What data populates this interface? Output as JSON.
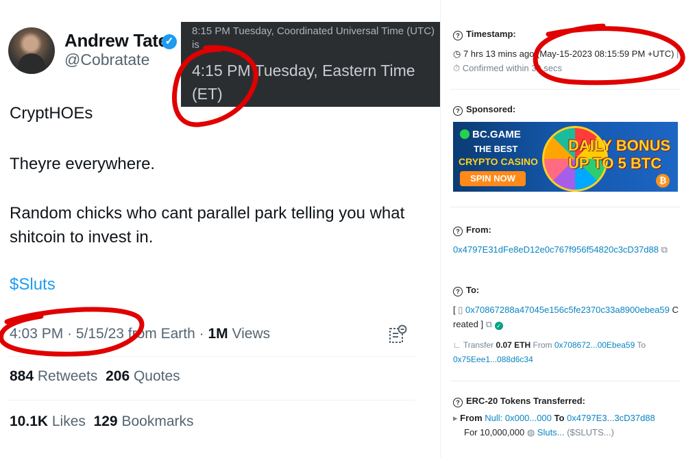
{
  "tweet": {
    "author_name": "Andrew Tate",
    "author_handle": "@Cobratate",
    "verified_icon": "verified-badge-icon",
    "lines": [
      "CryptHOEs",
      "Theyre everywhere.",
      "Random chicks who cant parallel park telling you what shitcoin to invest in."
    ],
    "cashtag": "$Sluts",
    "meta_time": "4:03 PM · 5/15/23 from Earth · ",
    "meta_views_count": "1M",
    "meta_views_label": " Views",
    "retweets_count": "884",
    "retweets_label": " Retweets",
    "quotes_count": "206",
    "quotes_label": " Quotes",
    "likes_count": "10.1K",
    "likes_label": " Likes",
    "bookmarks_count": "129",
    "bookmarks_label": " Bookmarks"
  },
  "tooltip": {
    "utc_line": "8:15 PM Tuesday, Coordinated Universal Time (UTC) is",
    "et_line": "4:15 PM Tuesday, Eastern Time (ET)"
  },
  "etherscan": {
    "timestamp_label": "Timestamp:",
    "timestamp_value": "7 hrs 13 mins ago (May-15-2023 08:15:59 PM +UTC)",
    "confirmed": "Confirmed within 30 secs",
    "sponsored_label": "Sponsored:",
    "banner": {
      "brand": "BC.GAME",
      "best": "THE BEST",
      "casino": "CRYPTO CASINO",
      "spin": "SPIN NOW",
      "daily": "DAILY BONUS",
      "upto": "UP TO 5 BTC"
    },
    "from_label": "From:",
    "from_address": "0x4797E31dFe8eD12e0c767f956f54820c3cD37d88",
    "to_label": "To:",
    "to_address": "0x70867288a47045e156c5fe2370c33a8900ebea59",
    "to_created": "Created ]",
    "transfer_prefix": "Transfer",
    "transfer_amount": "0.07 ETH",
    "transfer_from_label": "From",
    "transfer_from": "0x708672...00Ebea59",
    "transfer_to_label": "To",
    "transfer_to": "0x75Eee1...088d6c34",
    "erc20_label": "ERC-20 Tokens Transferred:",
    "erc20_from_label": "From",
    "erc20_from": "Null: 0x000...000",
    "erc20_to_label": "To",
    "erc20_to": "0x4797E3...3cD37d88",
    "erc20_for": "For 10,000,000",
    "erc20_token": "Sluts...",
    "erc20_symbol": "($SLUTS...)"
  },
  "colors": {
    "twitter_blue": "#1d9bf0",
    "etherscan_link": "#0784c3",
    "annotation_red": "#e00000"
  }
}
